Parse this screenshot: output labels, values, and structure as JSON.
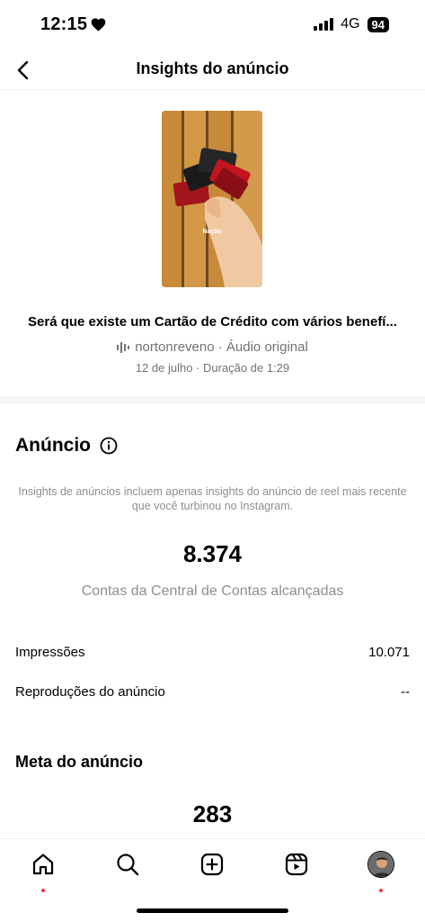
{
  "status_bar": {
    "time": "12:15",
    "network": "4G",
    "battery": "94"
  },
  "header": {
    "title": "Insights do anúncio"
  },
  "reel": {
    "thumbnail_caption": "Nação",
    "title": "Será que existe um Cartão de Crédito com vários benefí...",
    "audio": "nortonreveno · Áudio original",
    "date_duration": "12 de julho · Duração de 1:29"
  },
  "ad_section": {
    "heading": "Anúncio",
    "note": "Insights de anúncios incluem apenas insights do anúncio de reel mais recente que você turbinou no Instagram.",
    "reach_value": "8.374",
    "reach_label": "Contas da Central de Contas alcançadas",
    "metrics": [
      {
        "label": "Impressões",
        "value": "10.071"
      },
      {
        "label": "Reproduções do anúncio",
        "value": "--"
      }
    ]
  },
  "goal_section": {
    "heading": "Meta do anúncio",
    "value": "283"
  },
  "tab_bar": {
    "items": [
      "home-icon",
      "search-icon",
      "create-icon",
      "reels-icon",
      "profile-avatar"
    ],
    "notification_color": "#ff3040"
  }
}
